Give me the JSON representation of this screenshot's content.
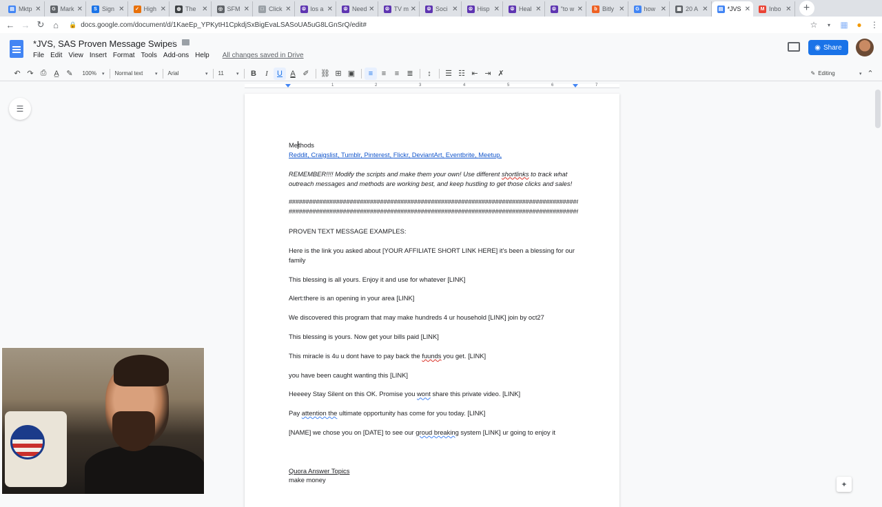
{
  "tabs": [
    {
      "title": "Mktp",
      "color": "#4285f4",
      "glyph": "▤"
    },
    {
      "title": "Mark",
      "color": "#5f6368",
      "glyph": "G"
    },
    {
      "title": "Sign",
      "color": "#1a73e8",
      "glyph": "S"
    },
    {
      "title": "High",
      "color": "#e8710a",
      "glyph": "✓"
    },
    {
      "title": "The",
      "color": "#3c4043",
      "glyph": "◍"
    },
    {
      "title": "SFM",
      "color": "#5f6368",
      "glyph": "◎"
    },
    {
      "title": "Click",
      "color": "#9aa0a6",
      "glyph": "□"
    },
    {
      "title": "los a",
      "color": "#5e35b1",
      "glyph": "☮"
    },
    {
      "title": "Need",
      "color": "#5e35b1",
      "glyph": "☮"
    },
    {
      "title": "TV m",
      "color": "#5e35b1",
      "glyph": "☮"
    },
    {
      "title": "Soci",
      "color": "#5e35b1",
      "glyph": "☮"
    },
    {
      "title": "Hisp",
      "color": "#5e35b1",
      "glyph": "☮"
    },
    {
      "title": "Heal",
      "color": "#5e35b1",
      "glyph": "☮"
    },
    {
      "title": "\"to w",
      "color": "#5e35b1",
      "glyph": "☮"
    },
    {
      "title": "Bitly",
      "color": "#ee6123",
      "glyph": "b"
    },
    {
      "title": "how",
      "color": "#4285f4",
      "glyph": "G"
    },
    {
      "title": "20 A",
      "color": "#5f6368",
      "glyph": "▦"
    },
    {
      "title": "*JVS",
      "color": "#4285f4",
      "glyph": "▤"
    },
    {
      "title": "Inbo",
      "color": "#ea4335",
      "glyph": "M"
    }
  ],
  "active_tab_index": 17,
  "address": {
    "url": "docs.google.com/document/d/1KaeEp_YPKytH1CpkdjSxBigEvaLSASoUA5uG8LGnSrQ/edit#"
  },
  "doc": {
    "title": "*JVS, SAS Proven Message Swipes",
    "menu": [
      "File",
      "Edit",
      "View",
      "Insert",
      "Format",
      "Tools",
      "Add-ons",
      "Help"
    ],
    "saved_status": "All changes saved in Drive",
    "share_label": "Share"
  },
  "toolbar": {
    "zoom": "100%",
    "style": "Normal text",
    "font": "Arial",
    "size": "11",
    "mode": "Editing"
  },
  "ruler": {
    "numbers": [
      "1",
      "2",
      "3",
      "4",
      "5",
      "6",
      "7"
    ]
  },
  "content": {
    "methods_heading_a": "Me",
    "methods_heading_b": "thods",
    "methods_links": [
      "Reddit",
      "Craigslist",
      "Tumblr",
      "Pinterest",
      "Flickr",
      "DeviantArt",
      "Eventbrite",
      "Meetup"
    ],
    "remember_a": "REMEMBER!!!! Modify the scripts and make them your own! Use different ",
    "remember_word": "shortlinks",
    "remember_b": " to track what outreach messages and methods are working best, and keep hustling to get those clicks and sales!",
    "hash_line": "########################################################################################",
    "proven_heading": "PROVEN TEXT MESSAGE EXAMPLES:",
    "m1": "Here is the link you asked about [YOUR AFFILIATE SHORT LINK HERE] it's been a blessing for our family",
    "m2": "This blessing is all yours. Enjoy it and use for whatever [LINK]",
    "m3": "Alert:there is an opening in your area [LINK]",
    "m4": "We discovered this program that may make hundreds 4 ur household [LINK]  join by oct27",
    "m5": "This blessing is yours. Now get your bills paid [LINK]",
    "m6_a": "This miracle is 4u u dont have to pay back the ",
    "m6_word": "fuunds",
    "m6_b": " you get. [LINK]",
    "m7": "you have been caught wanting this  [LINK]",
    "m8_a": "Heeeey Stay Silent on this OK. Promise you ",
    "m8_word": "wont",
    "m8_b": " share this private video. [LINK]",
    "m9_a": "Pay ",
    "m9_word": "attention the",
    "m9_b": " ultimate opportunity has come for you today. [LINK]",
    "m10_a": "[NAME] we chose you on [DATE] to see our ",
    "m10_word": "groud breaking",
    "m10_b": " system [LINK]  ur going to enjoy it",
    "quora_heading": "Quora Answer Topics",
    "quora_1": "make money"
  }
}
